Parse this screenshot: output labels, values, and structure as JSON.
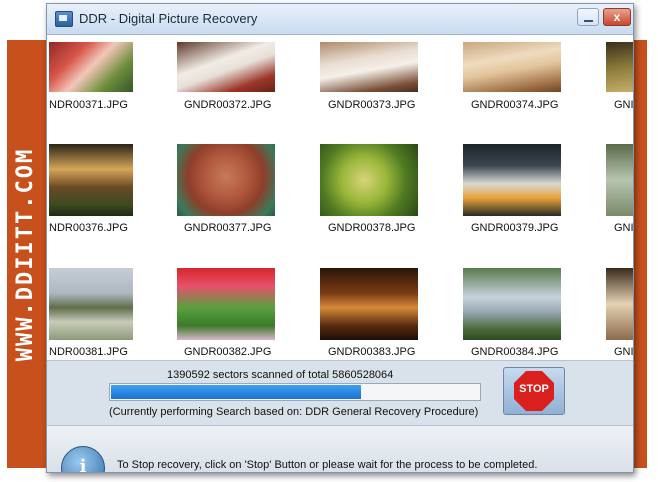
{
  "brand": {
    "text": "WWW.DDIITT.COM",
    "color": "#c8501c"
  },
  "window": {
    "title": "DDR - Digital Picture Recovery",
    "close_label": "x"
  },
  "gallery": {
    "rows": [
      [
        "NDR00371.JPG",
        "GNDR00372.JPG",
        "GNDR00373.JPG",
        "GNDR00374.JPG",
        "GNI"
      ],
      [
        "NDR00376.JPG",
        "GNDR00377.JPG",
        "GNDR00378.JPG",
        "GNDR00379.JPG",
        "GNI"
      ],
      [
        "NDR00381.JPG",
        "GNDR00382.JPG",
        "GNDR00383.JPG",
        "GNDR00384.JPG",
        "GNI"
      ]
    ]
  },
  "status": {
    "scan_text": "1390592 sectors scanned of total 5860528064",
    "progress_percent": 68,
    "search_text": "(Currently performing Search based on:  DDR General Recovery Procedure)",
    "stop_label": "STOP"
  },
  "info": {
    "icon": "info-icon",
    "glyph": "i",
    "text": "To Stop recovery, click on 'Stop' Button or please wait for the process to be completed."
  },
  "colors": {
    "accent": "#1d6fd0",
    "stop": "#d9201d"
  }
}
